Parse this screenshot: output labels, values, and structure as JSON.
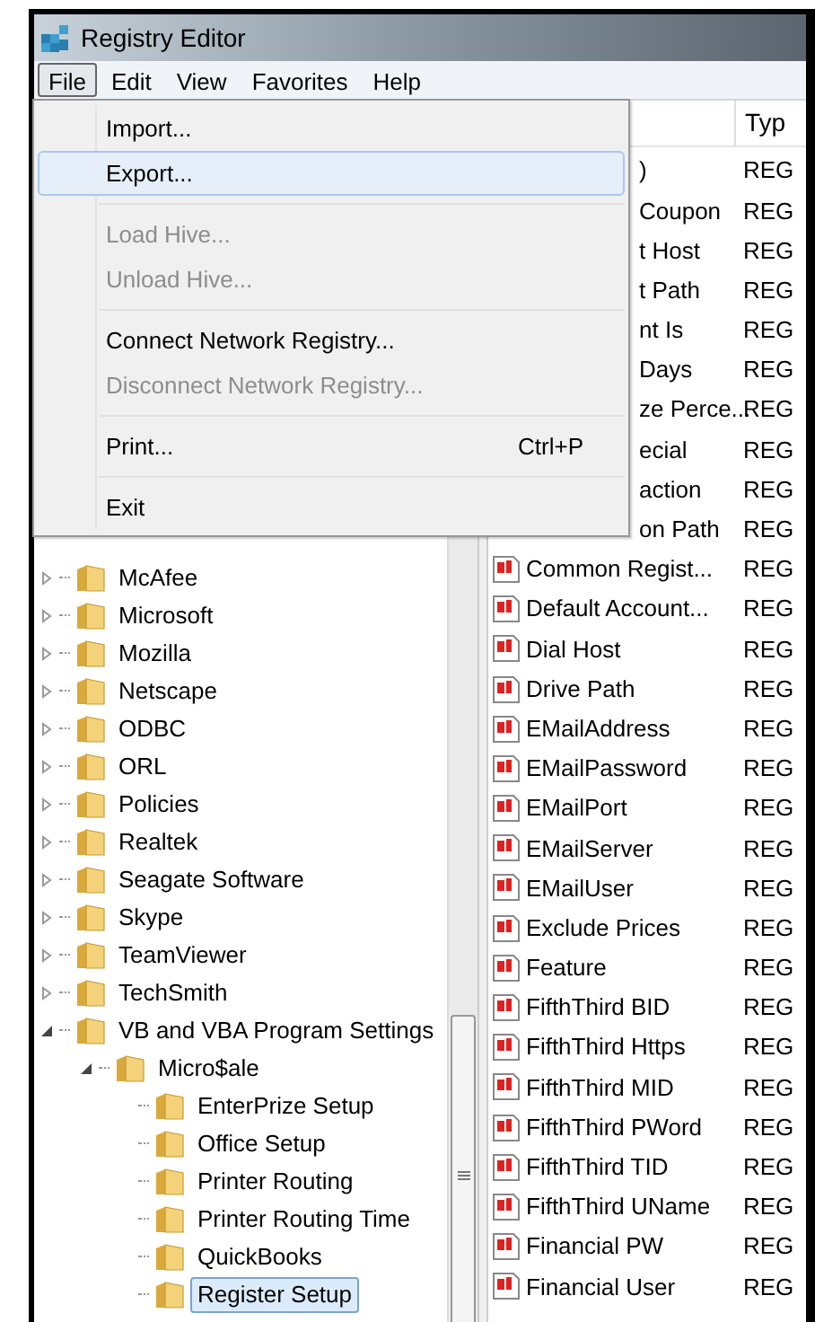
{
  "window": {
    "title": "Registry Editor"
  },
  "menu_bar": [
    {
      "label": "File",
      "selected": true
    },
    {
      "label": "Edit",
      "selected": false
    },
    {
      "label": "View",
      "selected": false
    },
    {
      "label": "Favorites",
      "selected": false
    },
    {
      "label": "Help",
      "selected": false
    }
  ],
  "file_menu": [
    {
      "kind": "item",
      "label": "Import...",
      "disabled": false,
      "selected": false
    },
    {
      "kind": "item",
      "label": "Export...",
      "disabled": false,
      "selected": true
    },
    {
      "kind": "separator"
    },
    {
      "kind": "item",
      "label": "Load Hive...",
      "disabled": true,
      "selected": false
    },
    {
      "kind": "item",
      "label": "Unload Hive...",
      "disabled": true,
      "selected": false
    },
    {
      "kind": "separator"
    },
    {
      "kind": "item",
      "label": "Connect Network Registry...",
      "disabled": false,
      "selected": false
    },
    {
      "kind": "item",
      "label": "Disconnect Network Registry...",
      "disabled": true,
      "selected": false
    },
    {
      "kind": "separator"
    },
    {
      "kind": "item",
      "label": "Print...",
      "shortcut": "Ctrl+P",
      "disabled": false,
      "selected": false
    },
    {
      "kind": "separator"
    },
    {
      "kind": "item",
      "label": "Exit",
      "disabled": false,
      "selected": false
    }
  ],
  "tree": [
    {
      "label": "McAfee",
      "expanded": false,
      "selected": false
    },
    {
      "label": "Microsoft",
      "expanded": false,
      "selected": false
    },
    {
      "label": "Mozilla",
      "expanded": false,
      "selected": false
    },
    {
      "label": "Netscape",
      "expanded": false,
      "selected": false
    },
    {
      "label": "ODBC",
      "expanded": false,
      "selected": false
    },
    {
      "label": "ORL",
      "expanded": false,
      "selected": false
    },
    {
      "label": "Policies",
      "expanded": false,
      "selected": false
    },
    {
      "label": "Realtek",
      "expanded": false,
      "selected": false
    },
    {
      "label": "Seagate Software",
      "expanded": false,
      "selected": false
    },
    {
      "label": "Skype",
      "expanded": false,
      "selected": false
    },
    {
      "label": "TeamViewer",
      "expanded": false,
      "selected": false
    },
    {
      "label": "TechSmith",
      "expanded": false,
      "selected": false
    },
    {
      "label": "VB and VBA Program Settings",
      "expanded": true,
      "selected": false,
      "children": [
        {
          "label": "Micro$ale",
          "expanded": true,
          "selected": false,
          "children": [
            {
              "label": "EnterPrize Setup",
              "selected": false
            },
            {
              "label": "Office Setup",
              "selected": false
            },
            {
              "label": "Printer Routing",
              "selected": false
            },
            {
              "label": "Printer Routing Time",
              "selected": false
            },
            {
              "label": "QuickBooks",
              "selected": false
            },
            {
              "label": "Register Setup",
              "selected": true
            }
          ]
        }
      ]
    }
  ],
  "values_list": {
    "columns": [
      "Typ"
    ],
    "rows_under_menu": [
      {
        "name": ")",
        "type": "REG"
      },
      {
        "name": "Coupon",
        "type": "REG"
      },
      {
        "name": "t Host",
        "type": "REG"
      },
      {
        "name": "t Path",
        "type": "REG"
      },
      {
        "name": "nt Is",
        "type": "REG"
      },
      {
        "name": "Days",
        "type": "REG"
      },
      {
        "name": "ze Perce...",
        "type": "REG"
      },
      {
        "name": "ecial",
        "type": "REG"
      },
      {
        "name": "action",
        "type": "REG"
      },
      {
        "name": "on Path",
        "type": "REG"
      }
    ],
    "rows": [
      {
        "name": "Common Regist...",
        "type": "REG"
      },
      {
        "name": "Default Account...",
        "type": "REG"
      },
      {
        "name": "Dial Host",
        "type": "REG"
      },
      {
        "name": "Drive Path",
        "type": "REG"
      },
      {
        "name": "EMailAddress",
        "type": "REG"
      },
      {
        "name": "EMailPassword",
        "type": "REG"
      },
      {
        "name": "EMailPort",
        "type": "REG"
      },
      {
        "name": "EMailServer",
        "type": "REG"
      },
      {
        "name": "EMailUser",
        "type": "REG"
      },
      {
        "name": "Exclude Prices",
        "type": "REG"
      },
      {
        "name": "Feature",
        "type": "REG"
      },
      {
        "name": "FifthThird BID",
        "type": "REG"
      },
      {
        "name": "FifthThird Https",
        "type": "REG"
      },
      {
        "name": "FifthThird MID",
        "type": "REG"
      },
      {
        "name": "FifthThird PWord",
        "type": "REG"
      },
      {
        "name": "FifthThird TID",
        "type": "REG"
      },
      {
        "name": "FifthThird UName",
        "type": "REG"
      },
      {
        "name": "Financial PW",
        "type": "REG"
      },
      {
        "name": "Financial User",
        "type": "REG"
      }
    ]
  }
}
